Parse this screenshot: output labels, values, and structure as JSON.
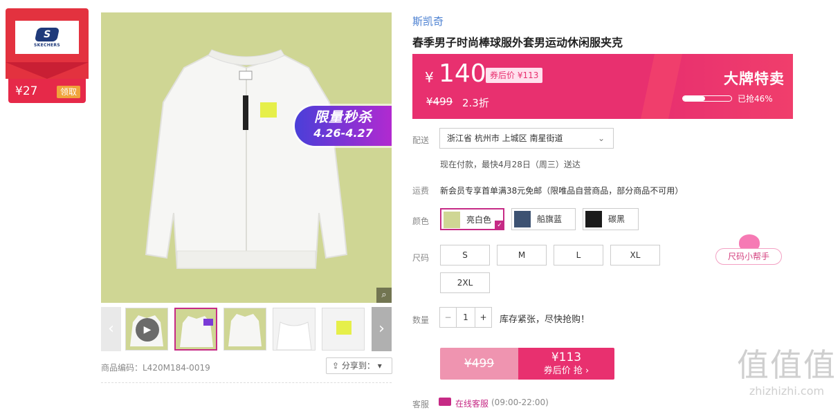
{
  "coupon": {
    "amount": "¥27",
    "button": "领取",
    "brand": "SKECHERS",
    "logo_letter": "S"
  },
  "gallery": {
    "flash_sale_title": "限量秒杀",
    "flash_sale_dates": "4.26-4.27",
    "zoom_icon": "magnifier-icon",
    "thumbnails": [
      {
        "kind": "video",
        "selected": false
      },
      {
        "kind": "image",
        "selected": true
      },
      {
        "kind": "image",
        "selected": false
      },
      {
        "kind": "image",
        "selected": false
      },
      {
        "kind": "image",
        "selected": false
      }
    ],
    "sku_label": "商品编码：L420M184-0019",
    "share_label": "分享到：",
    "share_chevron": "▾"
  },
  "product": {
    "brand": "斯凯奇",
    "title": "春季男子时尚棒球服外套男运动休闲服夹克"
  },
  "price": {
    "currency": "¥",
    "current": "140",
    "after_coupon_tag": "券后价 ¥113",
    "original": "¥499",
    "discount": "2.3折",
    "promo_title": "大牌特卖",
    "sold_text": "已抢46%",
    "sold_fraction": 0.46
  },
  "delivery": {
    "label": "配送",
    "address": "浙江省 杭州市 上城区 南星街道",
    "note": "现在付款，最快4月28日（周三）送达"
  },
  "shipping": {
    "label": "运费",
    "text": "新会员专享首单满38元免邮（限唯品自营商品，部分商品不可用）"
  },
  "colors": {
    "label": "颜色",
    "options": [
      {
        "name": "亮白色",
        "selected": true,
        "swatch": "#f2f2f2"
      },
      {
        "name": "船旗蓝",
        "selected": false,
        "swatch": "#3d5272"
      },
      {
        "name": "碳黑",
        "selected": false,
        "swatch": "#1b1b1b"
      }
    ]
  },
  "sizes": {
    "label": "尺码",
    "options": [
      "S",
      "M",
      "L",
      "XL",
      "2XL"
    ],
    "helper": "尺码小帮手"
  },
  "quantity": {
    "label": "数量",
    "value": "1",
    "minus": "−",
    "plus": "+",
    "stock_note": "库存紧张，尽快抢购！"
  },
  "buy": {
    "original": "¥499",
    "after_price": "¥113",
    "after_label": "券后价 抢 ›"
  },
  "service": {
    "label": "客服",
    "text": "在线客服",
    "hours": "(09:00-22:00)"
  },
  "watermark": {
    "chars": "值值值",
    "url": "zhizhizhi.com"
  },
  "colors_theme": {
    "accent": "#e8306f",
    "purple": "#c62a85",
    "link": "#4a7fd1",
    "image_bg": "#cfd694"
  }
}
